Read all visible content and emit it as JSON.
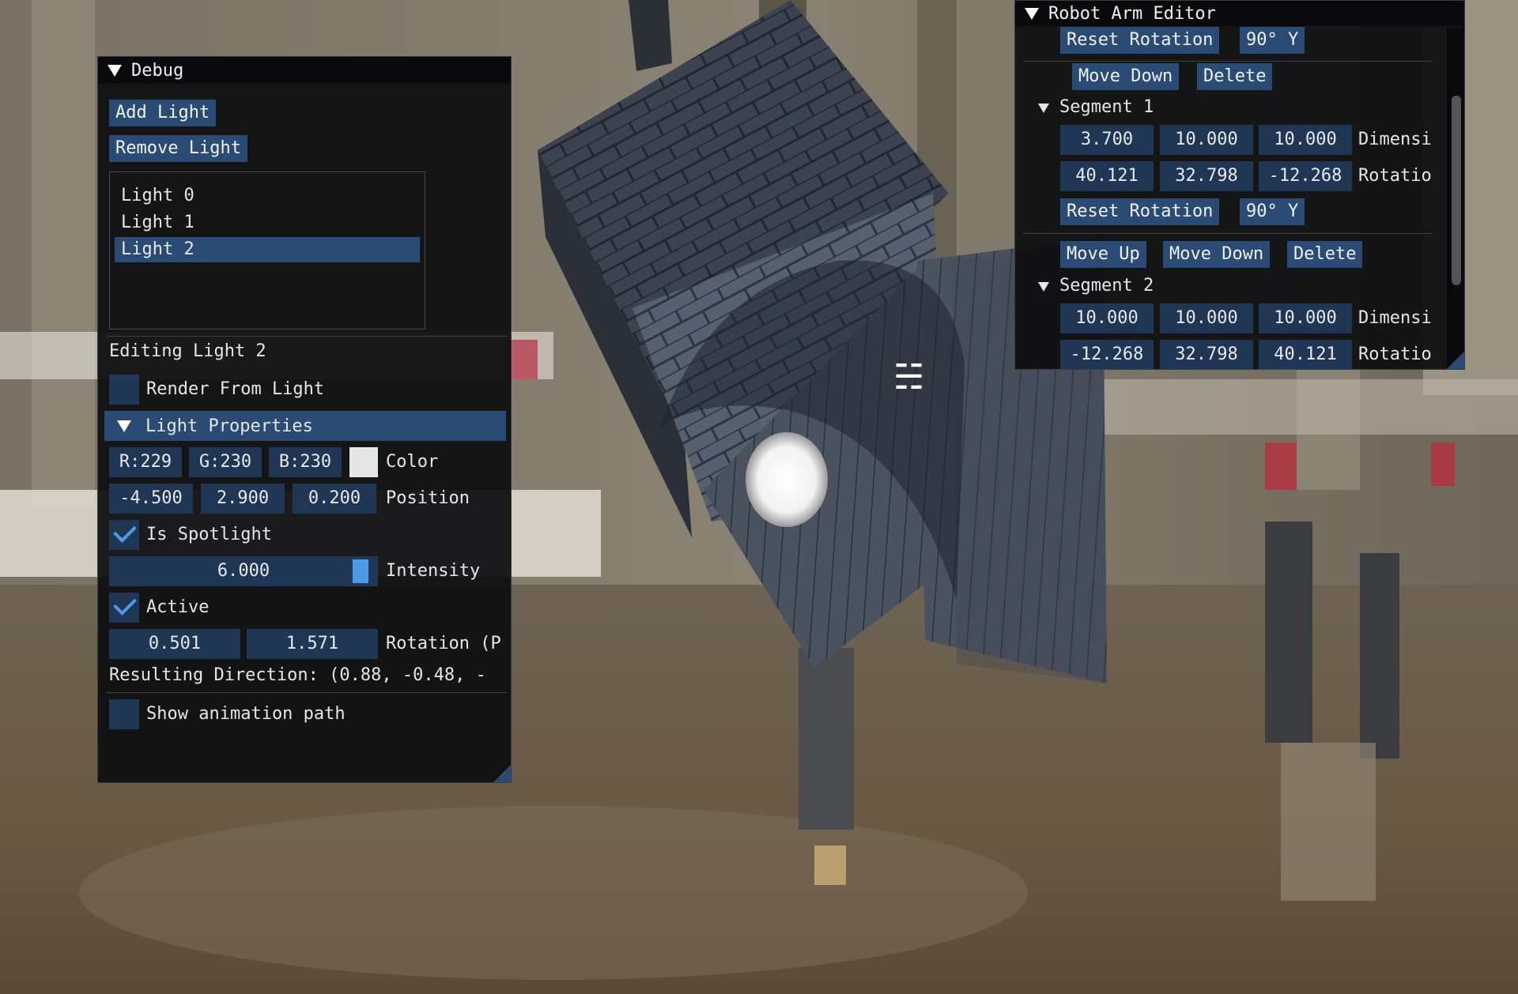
{
  "debug": {
    "title": "Debug",
    "add_light": "Add Light",
    "remove_light": "Remove Light",
    "lights": [
      "Light 0",
      "Light 1",
      "Light 2"
    ],
    "selected_light": "Light 2",
    "editing_label": "Editing Light 2",
    "render_from_light": "Render From Light",
    "render_from_light_checked": false,
    "light_properties": "Light Properties",
    "color": {
      "r": "R:229",
      "g": "G:230",
      "b": "B:230",
      "label": "Color",
      "swatch": "#e5e6e6"
    },
    "position": {
      "x": "-4.500",
      "y": "2.900",
      "z": "0.200",
      "label": "Position"
    },
    "is_spotlight": "Is Spotlight",
    "is_spotlight_checked": true,
    "intensity": {
      "value": "6.000",
      "label": "Intensity",
      "fill": 0.97
    },
    "active": "Active",
    "active_checked": true,
    "rotation": {
      "a": "0.501",
      "b": "1.571",
      "label": "Rotation (P"
    },
    "resulting_direction": "Resulting Direction: (0.88, -0.48, -",
    "show_animation_path": "Show animation path",
    "show_animation_path_checked": false
  },
  "robot_arm": {
    "title": "Robot Arm Editor",
    "reset_rotation_top": "Reset Rotation",
    "rot90_top": "90° Y",
    "move_down_top": "Move Down",
    "delete_top": "Delete",
    "segment1": {
      "title": "Segment 1",
      "dims": [
        "3.700",
        "10.000",
        "10.000"
      ],
      "dims_label": "Dimensi",
      "rot": [
        "40.121",
        "32.798",
        "-12.268"
      ],
      "rot_label": "Rotatio",
      "reset_rotation": "Reset Rotation",
      "rot90": "90° Y",
      "move_up": "Move Up",
      "move_down": "Move Down",
      "delete": "Delete"
    },
    "segment2": {
      "title": "Segment 2",
      "dims": [
        "10.000",
        "10.000",
        "10.000"
      ],
      "dims_label": "Dimensi",
      "rot": [
        "-12.268",
        "32.798",
        "40.121"
      ],
      "rot_label": "Rotatio"
    }
  },
  "colors": {
    "button": "#2a4c74",
    "field": "#1f3655",
    "check": "#4d9be8",
    "window_bg": "#0f0f11"
  }
}
